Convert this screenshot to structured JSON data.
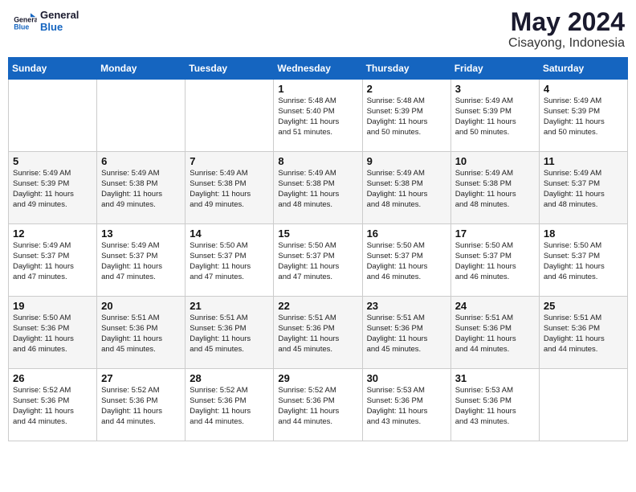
{
  "header": {
    "logo_line1": "General",
    "logo_line2": "Blue",
    "month_title": "May 2024",
    "location": "Cisayong, Indonesia"
  },
  "weekdays": [
    "Sunday",
    "Monday",
    "Tuesday",
    "Wednesday",
    "Thursday",
    "Friday",
    "Saturday"
  ],
  "weeks": [
    [
      {
        "day": "",
        "info": ""
      },
      {
        "day": "",
        "info": ""
      },
      {
        "day": "",
        "info": ""
      },
      {
        "day": "1",
        "info": "Sunrise: 5:48 AM\nSunset: 5:40 PM\nDaylight: 11 hours\nand 51 minutes."
      },
      {
        "day": "2",
        "info": "Sunrise: 5:48 AM\nSunset: 5:39 PM\nDaylight: 11 hours\nand 50 minutes."
      },
      {
        "day": "3",
        "info": "Sunrise: 5:49 AM\nSunset: 5:39 PM\nDaylight: 11 hours\nand 50 minutes."
      },
      {
        "day": "4",
        "info": "Sunrise: 5:49 AM\nSunset: 5:39 PM\nDaylight: 11 hours\nand 50 minutes."
      }
    ],
    [
      {
        "day": "5",
        "info": "Sunrise: 5:49 AM\nSunset: 5:39 PM\nDaylight: 11 hours\nand 49 minutes."
      },
      {
        "day": "6",
        "info": "Sunrise: 5:49 AM\nSunset: 5:38 PM\nDaylight: 11 hours\nand 49 minutes."
      },
      {
        "day": "7",
        "info": "Sunrise: 5:49 AM\nSunset: 5:38 PM\nDaylight: 11 hours\nand 49 minutes."
      },
      {
        "day": "8",
        "info": "Sunrise: 5:49 AM\nSunset: 5:38 PM\nDaylight: 11 hours\nand 48 minutes."
      },
      {
        "day": "9",
        "info": "Sunrise: 5:49 AM\nSunset: 5:38 PM\nDaylight: 11 hours\nand 48 minutes."
      },
      {
        "day": "10",
        "info": "Sunrise: 5:49 AM\nSunset: 5:38 PM\nDaylight: 11 hours\nand 48 minutes."
      },
      {
        "day": "11",
        "info": "Sunrise: 5:49 AM\nSunset: 5:37 PM\nDaylight: 11 hours\nand 48 minutes."
      }
    ],
    [
      {
        "day": "12",
        "info": "Sunrise: 5:49 AM\nSunset: 5:37 PM\nDaylight: 11 hours\nand 47 minutes."
      },
      {
        "day": "13",
        "info": "Sunrise: 5:49 AM\nSunset: 5:37 PM\nDaylight: 11 hours\nand 47 minutes."
      },
      {
        "day": "14",
        "info": "Sunrise: 5:50 AM\nSunset: 5:37 PM\nDaylight: 11 hours\nand 47 minutes."
      },
      {
        "day": "15",
        "info": "Sunrise: 5:50 AM\nSunset: 5:37 PM\nDaylight: 11 hours\nand 47 minutes."
      },
      {
        "day": "16",
        "info": "Sunrise: 5:50 AM\nSunset: 5:37 PM\nDaylight: 11 hours\nand 46 minutes."
      },
      {
        "day": "17",
        "info": "Sunrise: 5:50 AM\nSunset: 5:37 PM\nDaylight: 11 hours\nand 46 minutes."
      },
      {
        "day": "18",
        "info": "Sunrise: 5:50 AM\nSunset: 5:37 PM\nDaylight: 11 hours\nand 46 minutes."
      }
    ],
    [
      {
        "day": "19",
        "info": "Sunrise: 5:50 AM\nSunset: 5:36 PM\nDaylight: 11 hours\nand 46 minutes."
      },
      {
        "day": "20",
        "info": "Sunrise: 5:51 AM\nSunset: 5:36 PM\nDaylight: 11 hours\nand 45 minutes."
      },
      {
        "day": "21",
        "info": "Sunrise: 5:51 AM\nSunset: 5:36 PM\nDaylight: 11 hours\nand 45 minutes."
      },
      {
        "day": "22",
        "info": "Sunrise: 5:51 AM\nSunset: 5:36 PM\nDaylight: 11 hours\nand 45 minutes."
      },
      {
        "day": "23",
        "info": "Sunrise: 5:51 AM\nSunset: 5:36 PM\nDaylight: 11 hours\nand 45 minutes."
      },
      {
        "day": "24",
        "info": "Sunrise: 5:51 AM\nSunset: 5:36 PM\nDaylight: 11 hours\nand 44 minutes."
      },
      {
        "day": "25",
        "info": "Sunrise: 5:51 AM\nSunset: 5:36 PM\nDaylight: 11 hours\nand 44 minutes."
      }
    ],
    [
      {
        "day": "26",
        "info": "Sunrise: 5:52 AM\nSunset: 5:36 PM\nDaylight: 11 hours\nand 44 minutes."
      },
      {
        "day": "27",
        "info": "Sunrise: 5:52 AM\nSunset: 5:36 PM\nDaylight: 11 hours\nand 44 minutes."
      },
      {
        "day": "28",
        "info": "Sunrise: 5:52 AM\nSunset: 5:36 PM\nDaylight: 11 hours\nand 44 minutes."
      },
      {
        "day": "29",
        "info": "Sunrise: 5:52 AM\nSunset: 5:36 PM\nDaylight: 11 hours\nand 44 minutes."
      },
      {
        "day": "30",
        "info": "Sunrise: 5:53 AM\nSunset: 5:36 PM\nDaylight: 11 hours\nand 43 minutes."
      },
      {
        "day": "31",
        "info": "Sunrise: 5:53 AM\nSunset: 5:36 PM\nDaylight: 11 hours\nand 43 minutes."
      },
      {
        "day": "",
        "info": ""
      }
    ]
  ]
}
